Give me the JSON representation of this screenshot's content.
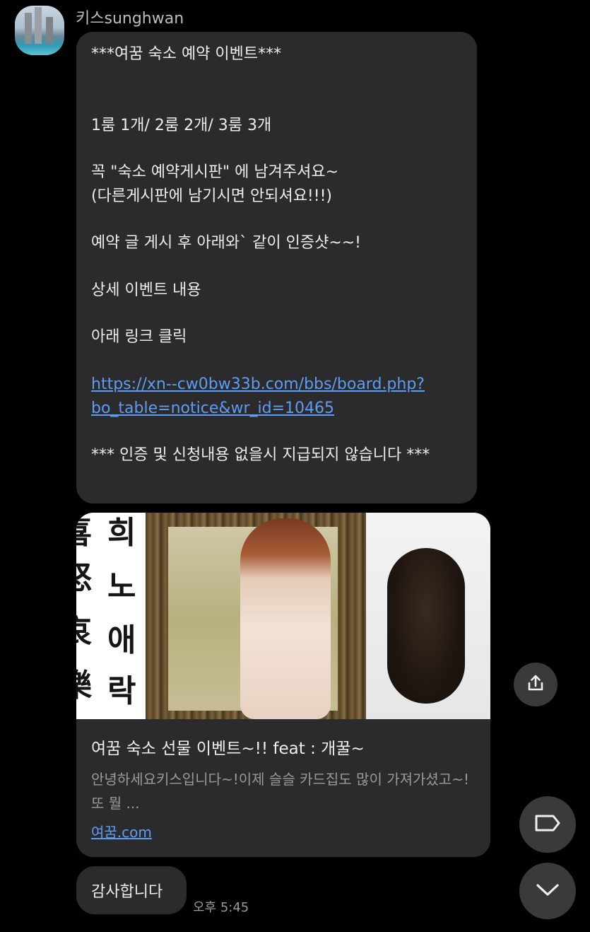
{
  "sender": {
    "name": "키스sunghwan"
  },
  "message": {
    "lines": [
      "***여꿈 숙소 예약 이벤트***",
      "1룸 1개/ 2룸 2개/ 3룸 3개",
      "꼭  \"숙소 예약게시판\" 에 남겨주셔요~",
      "(다른게시판에 남기시면 안되셔요!!!)",
      "예약 글 게시 후 아래와` 같이 인증샷~~!",
      "상세 이벤트 내용",
      "아래 링크 클릭",
      "*** 인증 및 신청내용 없을시 지급되지 않습니다 ***"
    ],
    "link_line1": "https://xn--cw0bw33b.com/bbs/board.php?",
    "link_line2": "bo_table=notice&wr_id=10465"
  },
  "link_preview": {
    "image_calligraphy_left": [
      "喜",
      "怒",
      "哀",
      "樂"
    ],
    "image_calligraphy_right": [
      "희",
      "노",
      "애",
      "락"
    ],
    "title": "여꿈 숙소 선물 이벤트~!! feat : 개꿀~",
    "description": "안녕하세요키스입니다~!이제 슬슬 카드집도 많이 가져가셨고~!또 뭘 ...",
    "domain": "여꿈.com"
  },
  "reply": {
    "text": "감사합니다",
    "timestamp": "오후 5:45"
  },
  "icons": {
    "share": "share-icon",
    "tag": "tag-icon",
    "scroll_down": "chevron-down-icon"
  },
  "colors": {
    "background": "#000000",
    "bubble": "#2b2b2d",
    "link": "#5f9cf2"
  }
}
